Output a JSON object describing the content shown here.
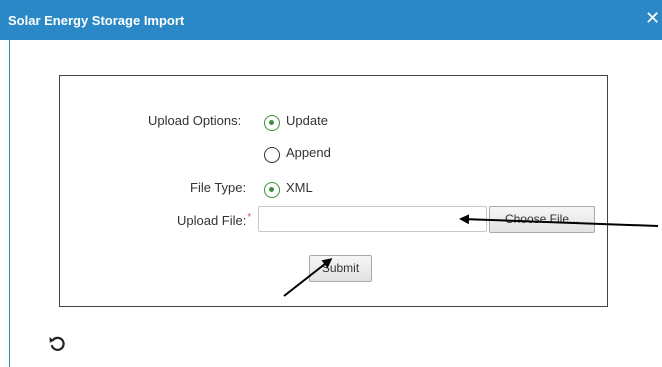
{
  "dialog": {
    "title": "Solar Energy Storage Import",
    "close_icon": "close-icon"
  },
  "form": {
    "upload_options_label": "Upload Options:",
    "option_update": "Update",
    "option_append": "Append",
    "selected_option": "Update",
    "file_type_label": "File Type:",
    "file_type_xml": "XML",
    "upload_file_label": "Upload File:",
    "required_mark": "*",
    "file_value": "",
    "choose_file_label": "Choose File...",
    "submit_label": "Submit"
  },
  "footer": {
    "reset_icon": "reset-icon"
  },
  "colors": {
    "title_bar": "#2b88c6",
    "radio_selected": "#3e8e3e",
    "required_mark": "#d9534f"
  }
}
